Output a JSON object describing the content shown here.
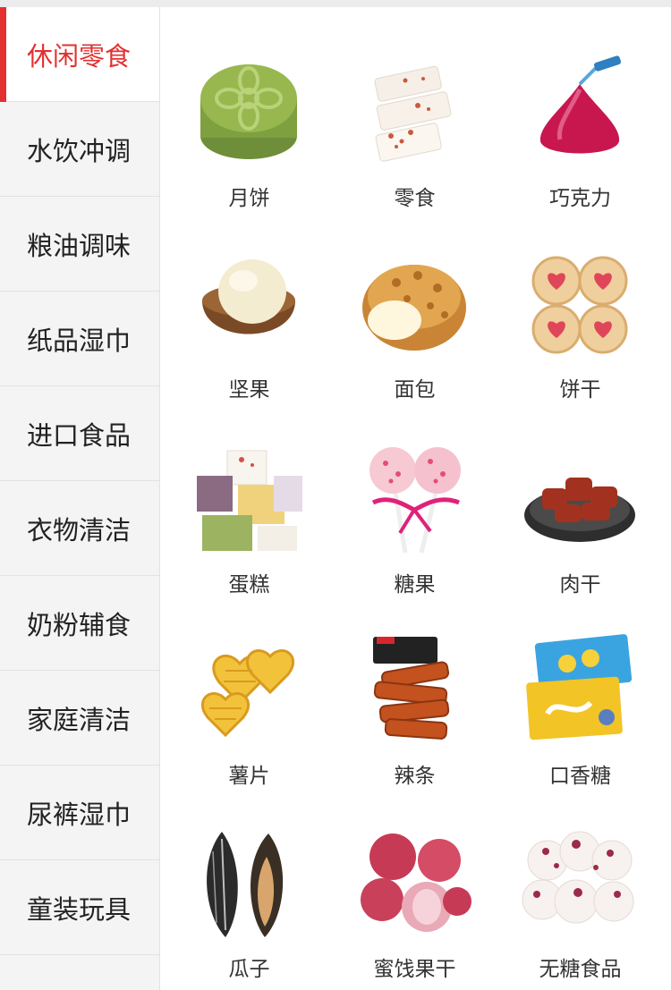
{
  "sidebar": {
    "items": [
      {
        "label": "休闲零食",
        "active": true
      },
      {
        "label": "水饮冲调",
        "active": false
      },
      {
        "label": "粮油调味",
        "active": false
      },
      {
        "label": "纸品湿巾",
        "active": false
      },
      {
        "label": "进口食品",
        "active": false
      },
      {
        "label": "衣物清洁",
        "active": false
      },
      {
        "label": "奶粉辅食",
        "active": false
      },
      {
        "label": "家庭清洁",
        "active": false
      },
      {
        "label": "尿裤湿巾",
        "active": false
      },
      {
        "label": "童装玩具",
        "active": false
      }
    ]
  },
  "products": [
    {
      "label": "月饼",
      "icon": "mooncake-icon"
    },
    {
      "label": "零食",
      "icon": "snack-icon"
    },
    {
      "label": "巧克力",
      "icon": "chocolate-icon"
    },
    {
      "label": "坚果",
      "icon": "nut-icon"
    },
    {
      "label": "面包",
      "icon": "bread-icon"
    },
    {
      "label": "饼干",
      "icon": "biscuit-icon"
    },
    {
      "label": "蛋糕",
      "icon": "cake-icon"
    },
    {
      "label": "糖果",
      "icon": "candy-icon"
    },
    {
      "label": "肉干",
      "icon": "jerky-icon"
    },
    {
      "label": "薯片",
      "icon": "chips-icon"
    },
    {
      "label": "辣条",
      "icon": "spicy-strip-icon"
    },
    {
      "label": "口香糖",
      "icon": "gum-icon"
    },
    {
      "label": "瓜子",
      "icon": "seeds-icon"
    },
    {
      "label": "蜜饯果干",
      "icon": "dried-fruit-icon"
    },
    {
      "label": "无糖食品",
      "icon": "sugar-free-icon"
    }
  ],
  "colors": {
    "accent": "#e3302f",
    "sidebar_bg": "#f4f4f4",
    "divider": "#e2e2e2"
  }
}
